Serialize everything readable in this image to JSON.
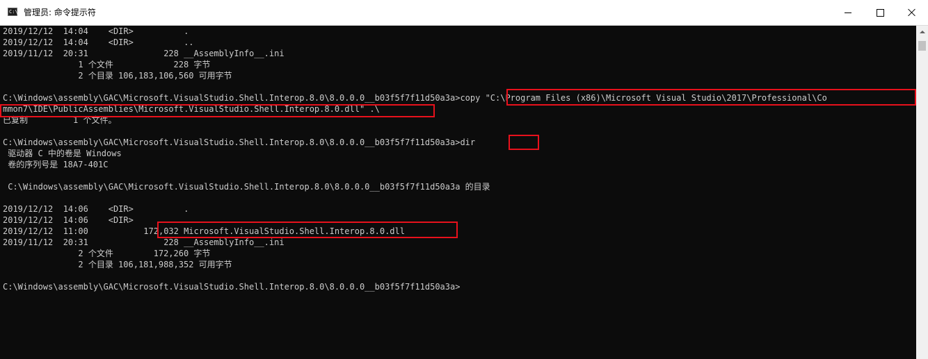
{
  "window": {
    "title": "管理员: 命令提示符",
    "app_icon_text": "C:\\",
    "controls": {
      "minimize": "minimize-icon",
      "maximize": "maximize-icon",
      "close": "close-icon"
    }
  },
  "console": {
    "lines": [
      "2019/12/12  14:04    <DIR>          .",
      "2019/12/12  14:04    <DIR>          ..",
      "2019/11/12  20:31               228 __AssemblyInfo__.ini",
      "               1 个文件            228 字节",
      "               2 个目录 106,183,106,560 可用字节",
      "",
      "C:\\Windows\\assembly\\GAC\\Microsoft.VisualStudio.Shell.Interop.8.0\\8.0.0.0__b03f5f7f11d50a3a>copy \"C:\\Program Files (x86)\\Microsoft Visual Studio\\2017\\Professional\\Co",
      "mmon7\\IDE\\PublicAssemblies\\Microsoft.VisualStudio.Shell.Interop.8.0.dll\" .\\",
      "已复制         1 个文件。",
      "",
      "C:\\Windows\\assembly\\GAC\\Microsoft.VisualStudio.Shell.Interop.8.0\\8.0.0.0__b03f5f7f11d50a3a>dir",
      " 驱动器 C 中的卷是 Windows",
      " 卷的序列号是 18A7-401C",
      "",
      " C:\\Windows\\assembly\\GAC\\Microsoft.VisualStudio.Shell.Interop.8.0\\8.0.0.0__b03f5f7f11d50a3a 的目录",
      "",
      "2019/12/12  14:06    <DIR>          .",
      "2019/12/12  14:06    <DIR>          ..",
      "2019/12/12  11:00           172,032 Microsoft.VisualStudio.Shell.Interop.8.0.dll",
      "2019/11/12  20:31               228 __AssemblyInfo__.ini",
      "               2 个文件        172,260 字节",
      "               2 个目录 106,181,988,352 可用字节",
      "",
      "C:\\Windows\\assembly\\GAC\\Microsoft.VisualStudio.Shell.Interop.8.0\\8.0.0.0__b03f5f7f11d50a3a>"
    ]
  },
  "colors": {
    "console_background": "#0c0c0c",
    "console_text": "#cccccc",
    "highlight_border": "#e8111c",
    "titlebar_background": "#ffffff"
  }
}
